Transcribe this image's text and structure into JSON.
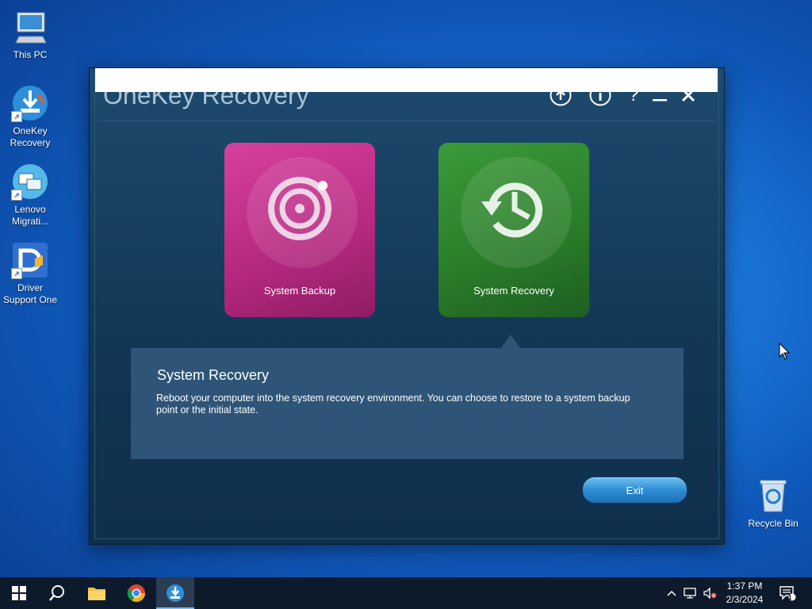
{
  "desktop": {
    "icons": [
      {
        "label": "This PC"
      },
      {
        "label": "OneKey Recovery"
      },
      {
        "label": "Lenovo Migrati..."
      },
      {
        "label": "Driver Support One"
      },
      {
        "label": "Recycle Bin"
      }
    ]
  },
  "window": {
    "title": "OneKey Recovery",
    "controls": [
      "upload-icon",
      "info-icon",
      "help-icon",
      "minimize-icon",
      "close-icon"
    ]
  },
  "tiles": [
    {
      "label": "System Backup",
      "color": "#c2338c",
      "icon": "backup-disc-icon"
    },
    {
      "label": "System Recovery",
      "color": "#2f8a2e",
      "icon": "recovery-clock-icon"
    }
  ],
  "info": {
    "title": "System Recovery",
    "description": "Reboot your computer into the system recovery environment. You can choose to restore to a system backup point or the initial state."
  },
  "exit_label": "Exit",
  "taskbar": {
    "apps": [
      "start-icon",
      "search-icon",
      "file-explorer-icon",
      "chrome-icon",
      "onekey-recovery-icon"
    ],
    "clock": {
      "time": "1:37 PM",
      "date": "2/3/2024"
    },
    "notification_count": "1"
  }
}
